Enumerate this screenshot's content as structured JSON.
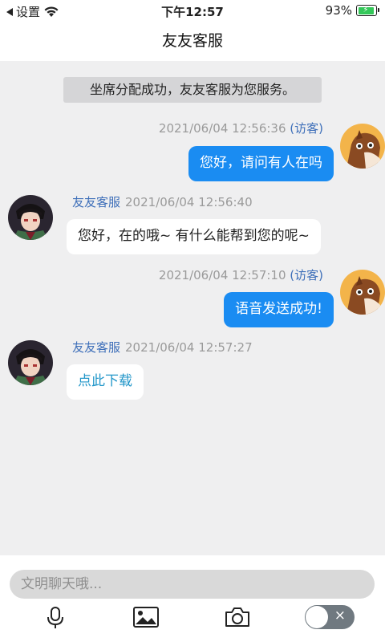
{
  "status_bar": {
    "back_label": "设置",
    "time": "下午12:57",
    "battery_percent": "93%",
    "battery_level": 0.93
  },
  "header": {
    "title": "友友客服"
  },
  "chat": {
    "system_message": "坐席分配成功，友友客服为您服务。",
    "messages": [
      {
        "from": "visitor",
        "timestamp": "2021/06/04 12:56:36",
        "tag": "(访客)",
        "text": "您好，请问有人在吗"
      },
      {
        "from": "agent",
        "name": "友友客服",
        "timestamp": "2021/06/04 12:56:40",
        "text": "您好，在的哦~ 有什么能帮到您的呢~"
      },
      {
        "from": "visitor",
        "timestamp": "2021/06/04 12:57:10",
        "tag": "(访客)",
        "text": "语音发送成功!"
      },
      {
        "from": "agent",
        "name": "友友客服",
        "timestamp": "2021/06/04 12:57:27",
        "text": "点此下载"
      }
    ]
  },
  "input": {
    "placeholder": "文明聊天哦..."
  },
  "toolbar": {
    "icons": [
      "microphone-icon",
      "image-icon",
      "camera-icon",
      "toggle-switch"
    ],
    "toggle_symbol": "×"
  },
  "colors": {
    "outgoing_bubble": "#1a8cf2",
    "accent_name": "#3e6fb9",
    "link_text": "#2196c9",
    "background": "#efeff0"
  }
}
